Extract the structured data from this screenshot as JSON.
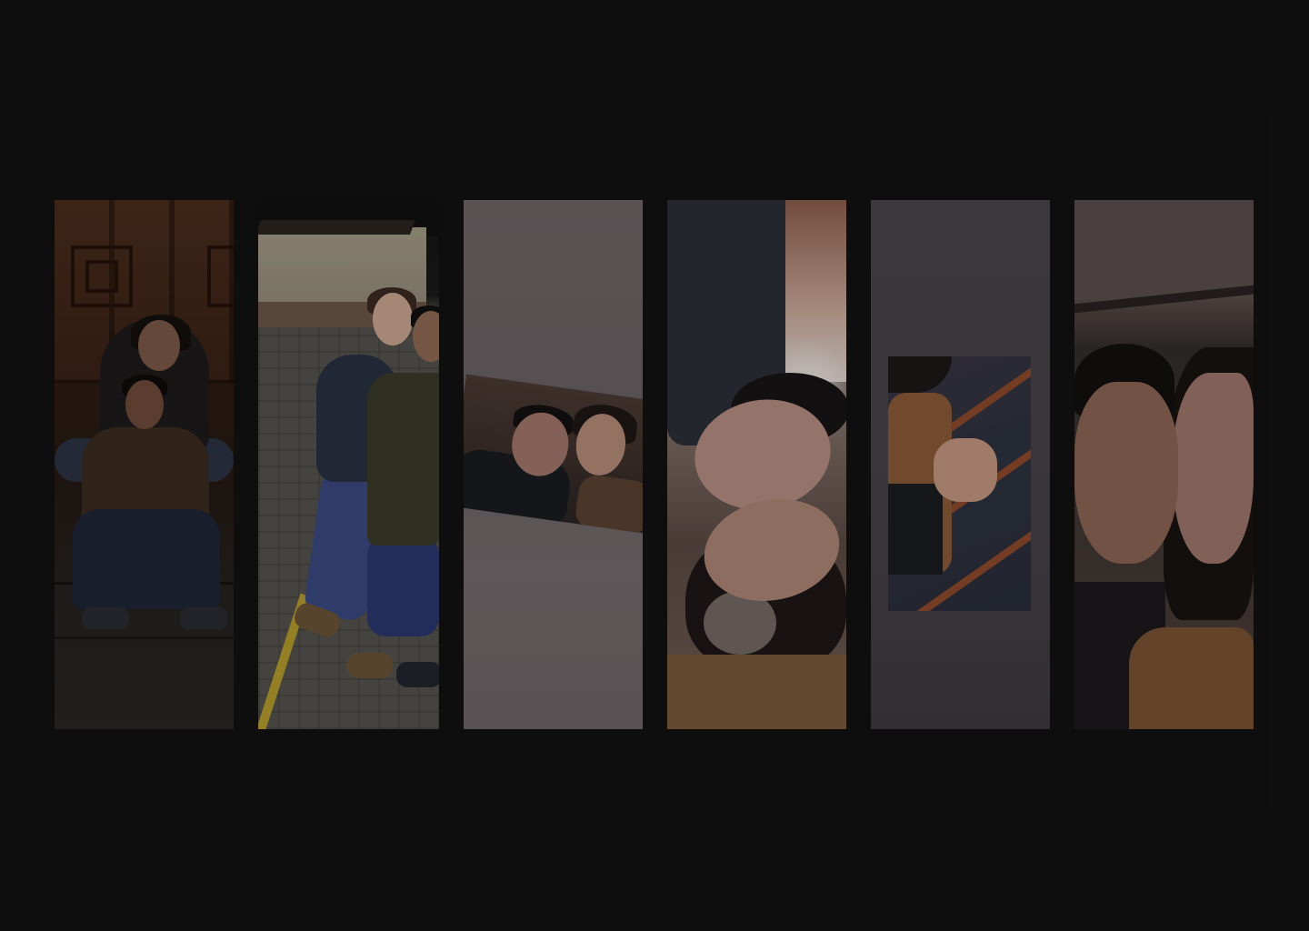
{
  "gallery": {
    "background_color": "#121212",
    "panels": [
      {
        "name": "photo-panel-1",
        "subject": "couple-sitting-steps-photo"
      },
      {
        "name": "photo-panel-2",
        "subject": "couple-hugging-street-photo"
      },
      {
        "name": "photo-panel-3",
        "subject": "tilted-selfie-photo"
      },
      {
        "name": "photo-panel-4",
        "subject": "upside-down-kiss-photo"
      },
      {
        "name": "photo-panel-5",
        "subject": "holding-hands-photo"
      },
      {
        "name": "photo-panel-6",
        "subject": "closeup-selfie-photo"
      }
    ]
  }
}
